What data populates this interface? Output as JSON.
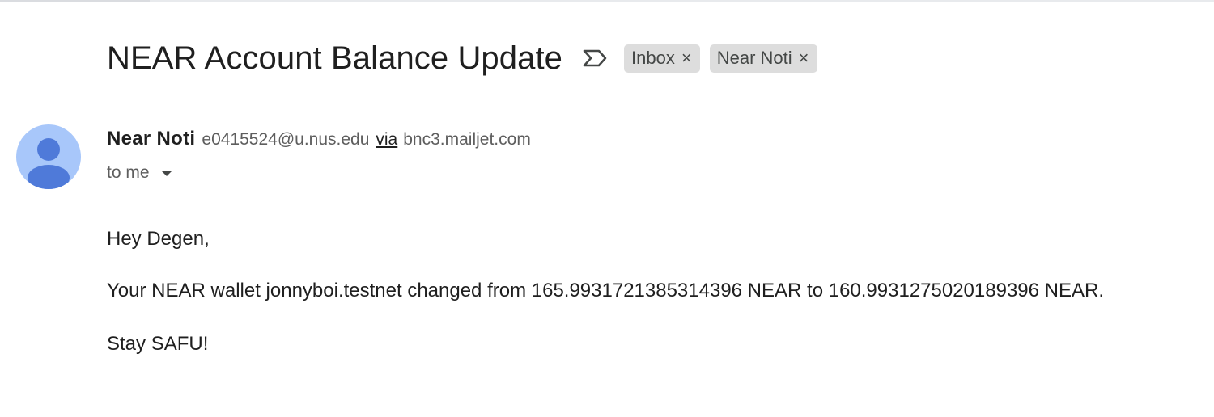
{
  "email": {
    "subject": "NEAR Account Balance Update",
    "labels": [
      {
        "name": "Inbox",
        "remove": "×"
      },
      {
        "name": "Near Noti",
        "remove": "×"
      }
    ],
    "sender": {
      "name": "Near Noti",
      "email": "e0415524@u.nus.edu",
      "via_text": "via",
      "via_domain": "bnc3.mailjet.com"
    },
    "recipient_text": "to me",
    "body": {
      "greeting": "Hey Degen,",
      "message": "Your NEAR wallet jonnyboi.testnet changed from 165.9931721385314396 NEAR to 160.9931275020189396 NEAR.",
      "signoff": "Stay SAFU!"
    }
  },
  "icons": {
    "importance": "importance-marker-icon",
    "avatar": "default-avatar-icon",
    "remove_label": "close-icon",
    "recipient_details": "caret-down-icon"
  },
  "colors": {
    "avatar_bg": "#a8c7fa",
    "avatar_fg": "#4f7ad9",
    "chip_bg": "#dddddd",
    "text_primary": "#1f1f1f",
    "text_secondary": "#5e5e5e"
  }
}
